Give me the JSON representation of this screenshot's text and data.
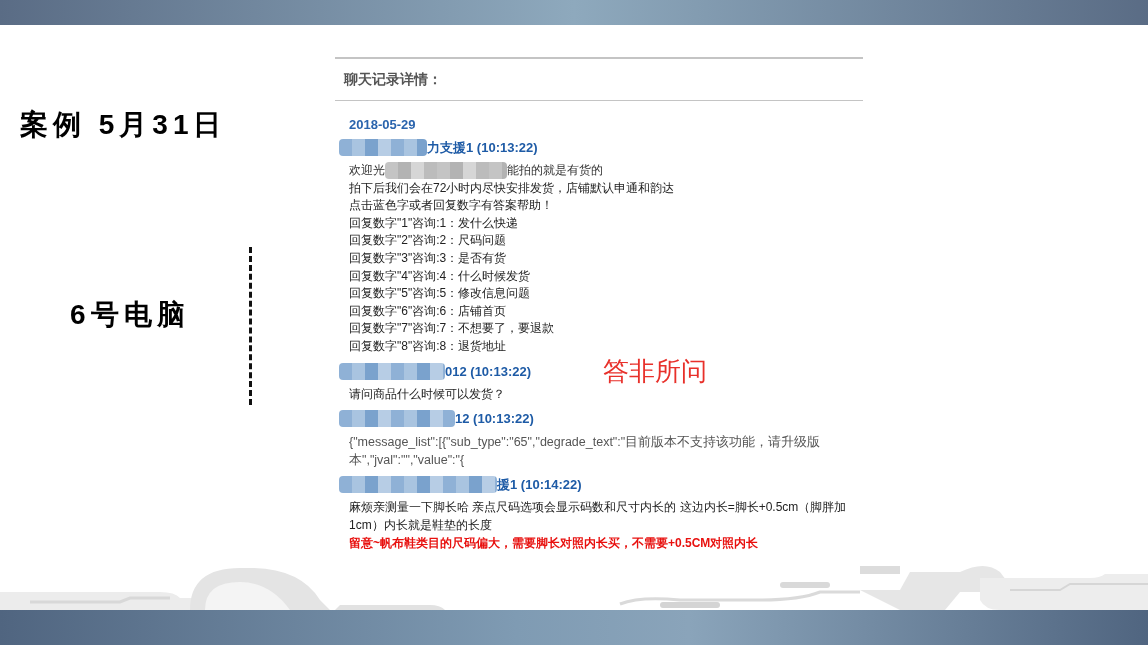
{
  "slide": {
    "title": "案例 5月31日",
    "subtitle": "6号电脑",
    "annotation": "答非所问"
  },
  "chat_log": {
    "heading": "聊天记录详情：",
    "date": "2018-05-29",
    "messages": [
      {
        "sender": "力支援1 (10:13:22)",
        "sender_redacted": true,
        "lines": [
          {
            "kind": "redacted",
            "before": "欢迎光",
            "after": "能拍的就是有货的"
          },
          {
            "kind": "plain",
            "text": "拍下后我们会在72小时内尽快安排发货，店铺默认申通和韵达"
          },
          {
            "kind": "plain",
            "text": "点击蓝色字或者回复数字有答案帮助！"
          },
          {
            "kind": "plain",
            "text": "回复数字\"1\"咨询:1：发什么快递"
          },
          {
            "kind": "plain",
            "text": "回复数字\"2\"咨询:2：尺码问题"
          },
          {
            "kind": "plain",
            "text": "回复数字\"3\"咨询:3：是否有货"
          },
          {
            "kind": "plain",
            "text": "回复数字\"4\"咨询:4：什么时候发货"
          },
          {
            "kind": "plain",
            "text": "回复数字\"5\"咨询:5：修改信息问题"
          },
          {
            "kind": "plain",
            "text": "回复数字\"6\"咨询:6：店铺首页"
          },
          {
            "kind": "plain",
            "text": "回复数字\"7\"咨询:7：不想要了，要退款"
          },
          {
            "kind": "plain",
            "text": "回复数字\"8\"咨询:8：退货地址"
          }
        ]
      },
      {
        "sender": "012 (10:13:22)",
        "sender_redacted": true,
        "lines": [
          {
            "kind": "plain",
            "text": "请问商品什么时候可以发货？"
          }
        ]
      },
      {
        "sender": "12 (10:13:22)",
        "sender_redacted": true,
        "lines": [
          {
            "kind": "raw",
            "text": "{\"message_list\":[{\"sub_type\":\"65\",\"degrade_text\":\"目前版本不支持该功能，请升级版本\",\"jval\":\"\",\"value\":\"{"
          }
        ]
      },
      {
        "sender": "援1 (10:14:22)",
        "sender_redacted": true,
        "lines": [
          {
            "kind": "plain",
            "text": "麻烦亲测量一下脚长哈 亲点尺码选项会显示码数和尺寸内长的 这边内长=脚长+0.5cm（脚胖加1cm）内长就是鞋垫的长度"
          },
          {
            "kind": "warning",
            "text": "留意~帆布鞋类目的尺码偏大，需要脚长对照内长买，不需要+0.5CM对照内长"
          }
        ]
      }
    ]
  }
}
